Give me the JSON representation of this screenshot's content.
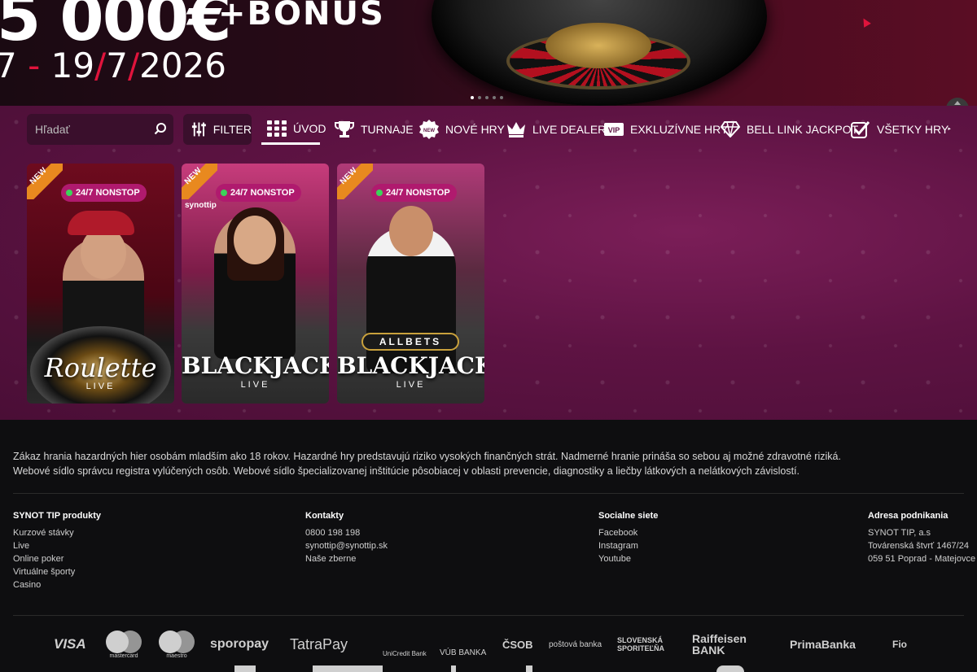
{
  "banner": {
    "amount": "5 000€",
    "bonus": "+BONUS",
    "date_start": "7",
    "date_sep": " - ",
    "date_day": "19",
    "date_month": "7",
    "date_year": "2026",
    "slide_count": 5,
    "active_slide": 1
  },
  "nav": {
    "search_placeholder": "Hľadať",
    "filter_label": "FILTER",
    "items": [
      {
        "label": "ÚVOD",
        "icon": "grid-icon",
        "active": true
      },
      {
        "label": "TURNAJE",
        "icon": "trophy-icon"
      },
      {
        "label": "NOVÉ HRY",
        "icon": "new-badge-icon",
        "icon_text": "NEW"
      },
      {
        "label": "LIVE DEALER",
        "icon": "crown-icon"
      },
      {
        "label": "EXKLUZÍVNE HRY",
        "icon": "vip-icon",
        "icon_text": "VIP"
      },
      {
        "label": "BELL LINK JACKPOT",
        "icon": "diamond-icon"
      },
      {
        "label": "VŠETKY HRY",
        "icon": "checkbox-icon"
      }
    ]
  },
  "games": [
    {
      "ribbon": "NEW",
      "badge": "24/7 NONSTOP",
      "title": "Roulette",
      "subtitle": "LIVE"
    },
    {
      "ribbon": "NEW",
      "badge": "24/7 NONSTOP",
      "title": "BLACKJACK",
      "subtitle": "LIVE"
    },
    {
      "ribbon": "NEW",
      "badge": "24/7 NONSTOP",
      "title": "BLACKJACK",
      "subtitle": "LIVE",
      "brand": "ALLBETS"
    }
  ],
  "footer": {
    "disclaimer_1": "Zákaz hrania hazardných hier osobám mladším ako 18 rokov. Hazardné hry predstavujú riziko vysokých finančných strát. Nadmerné hranie prináša so sebou aj možné zdravotné riziká.",
    "disclaimer_2": "Webové sídlo správcu registra vylúčených osôb. Webové sídlo špecializovanej inštitúcie pôsobiacej v oblasti prevencie, diagnostiky a liečby látkových a nelátkových závislostí.",
    "products": {
      "title": "SYNOT TIP produkty",
      "links": [
        "Kurzové stávky",
        "Live",
        "Online poker",
        "Virtuálne športy",
        "Casino"
      ]
    },
    "contacts": {
      "title": "Kontakty",
      "links": [
        "0800 198 198",
        "synottip@synottip.sk",
        "Naše zberne"
      ]
    },
    "social": {
      "title": "Socialne siete",
      "links": [
        "Facebook",
        "Instagram",
        "Youtube"
      ]
    },
    "address": {
      "title": "Adresa podnikania",
      "lines": [
        "SYNOT TIP, a.s",
        "Továrenská štvrť 1467/24",
        "059 51 Poprad - Matejovce"
      ]
    },
    "payment_logos": [
      "VISA",
      "mastercard",
      "maestro",
      "sporopay",
      "TatraPay",
      "UniCredit Bank",
      "VÚB BANKA",
      "ČSOB",
      "poštová banka",
      "SLOVENSKÁ SPORITEĽŇA",
      "Raiffeisen BANK",
      "PrimaBanka",
      "Fio"
    ]
  }
}
